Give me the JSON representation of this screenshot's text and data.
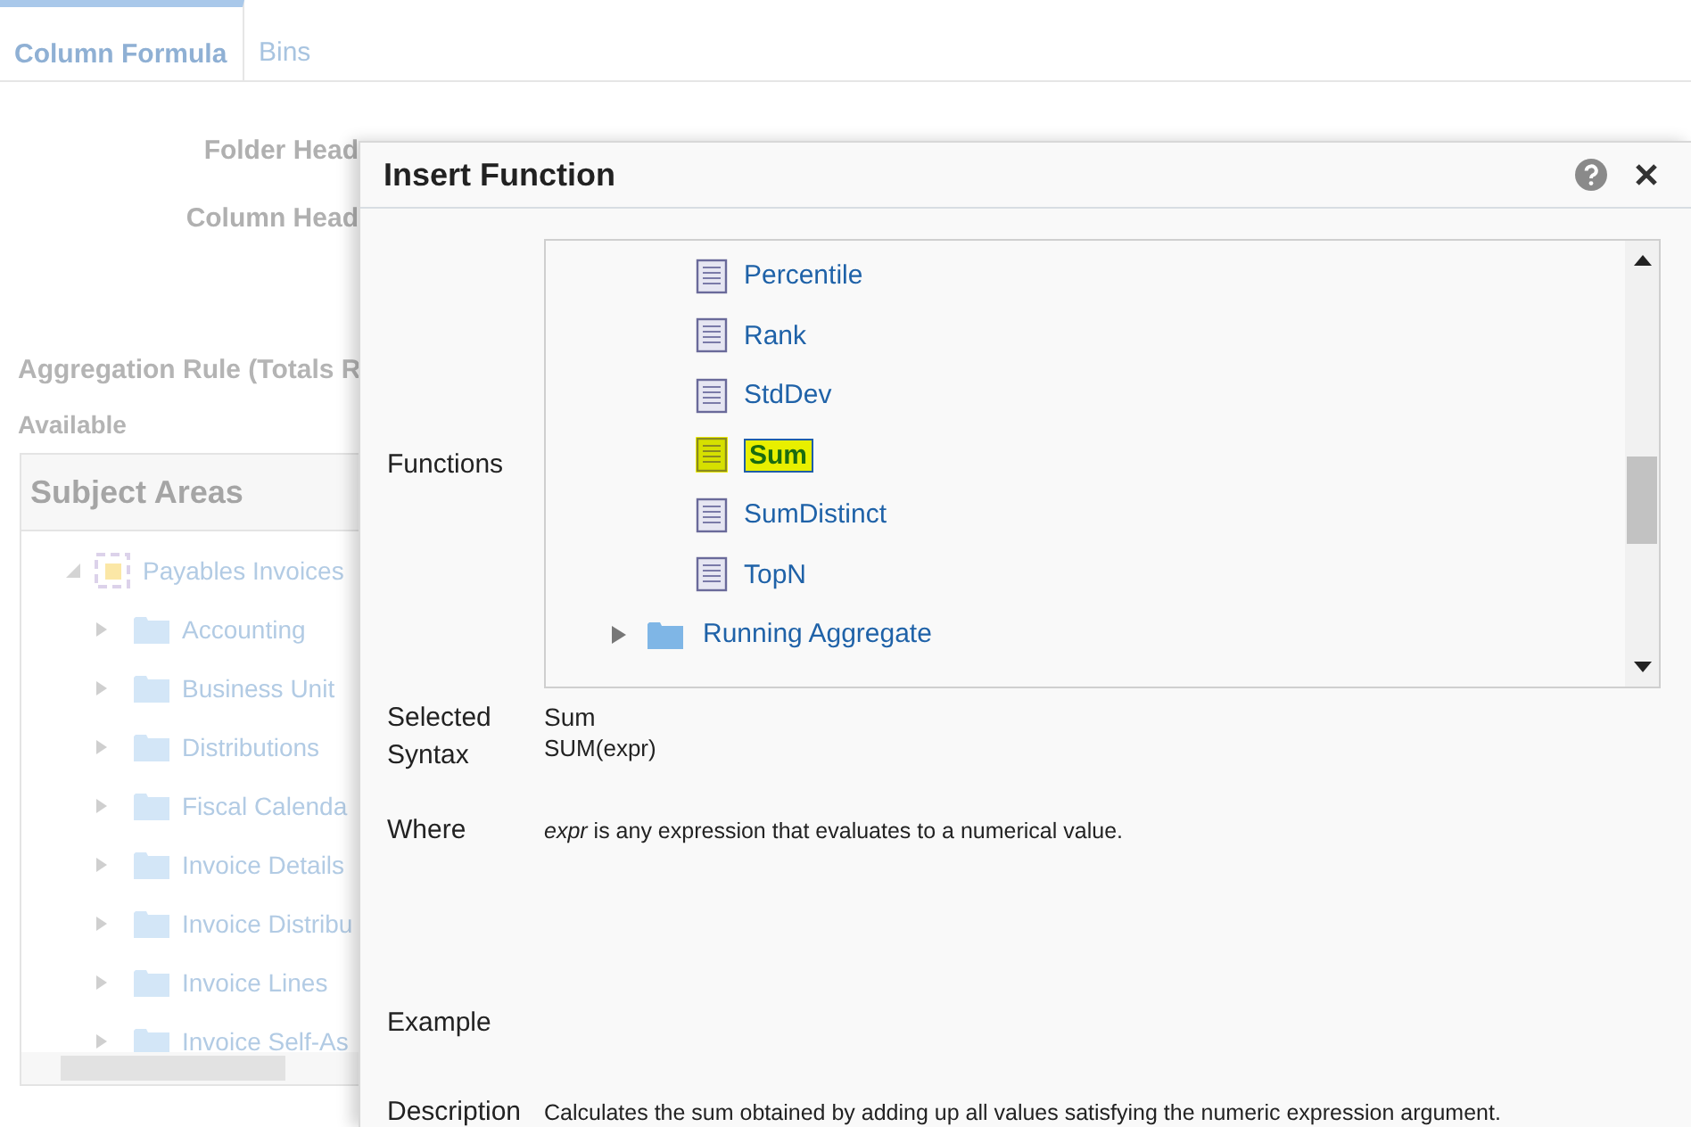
{
  "tabs": [
    {
      "label": "Column Formula",
      "selected": true
    },
    {
      "label": "Bins",
      "selected": false
    }
  ],
  "form": {
    "folder_heading_label": "Folder Head",
    "column_heading_label": "Column Head",
    "aggregation_rule_label": "Aggregation Rule (Totals R",
    "available_label": "Available"
  },
  "subject_areas": {
    "title": "Subject Areas",
    "tree": [
      {
        "label": "Payables Invoices",
        "expanded": true,
        "children": [
          {
            "label": "Accounting",
            "expanded": false
          },
          {
            "label": "Business Unit",
            "expanded": false
          },
          {
            "label": "Distributions",
            "expanded": false
          },
          {
            "label": "Fiscal Calenda",
            "expanded": false
          },
          {
            "label": "Invoice Details",
            "expanded": false
          },
          {
            "label": "Invoice Distribu",
            "expanded": false
          },
          {
            "label": "Invoice Lines",
            "expanded": false
          },
          {
            "label": "Invoice Self-As",
            "expanded": false
          }
        ]
      }
    ]
  },
  "dialog": {
    "title": "Insert Function",
    "functions_label": "Functions",
    "function_items": [
      {
        "label": "Percentile",
        "selected": false
      },
      {
        "label": "Rank",
        "selected": false
      },
      {
        "label": "StdDev",
        "selected": false
      },
      {
        "label": "Sum",
        "selected": true
      },
      {
        "label": "SumDistinct",
        "selected": false
      },
      {
        "label": "TopN",
        "selected": false
      }
    ],
    "folders": [
      {
        "label": "Running Aggregate",
        "expanded": false
      }
    ],
    "fields": [
      {
        "label": "Selected",
        "value": "Sum",
        "kind": "plain"
      },
      {
        "label": "Syntax",
        "value": "SUM(expr)",
        "kind": "code"
      },
      {
        "label": "Where",
        "value": "*expr* is any expression that evaluates to a numerical value.",
        "kind": "rich"
      },
      {
        "label": "Example"
      },
      {
        "label": "Description",
        "value": "Calculates the sum obtained by adding up all values satisfying the numeric expression argument.",
        "kind": "plain"
      }
    ]
  }
}
